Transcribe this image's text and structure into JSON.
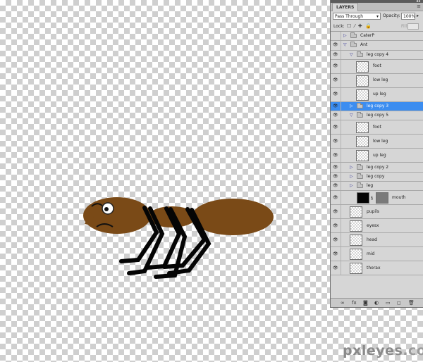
{
  "panel": {
    "tab_label": "LAYERS",
    "menu_icon": "panel-menu-icon",
    "blend_mode": "Pass Through",
    "opacity_label": "Opacity:",
    "opacity_value": "100%",
    "lock_label": "Lock:",
    "lock_icons": "☐ ⁄ ✚ 🔒",
    "fill_label": "Fill:"
  },
  "layers": [
    {
      "name": "CaterP",
      "kind": "group",
      "expanded": false,
      "indent": 0,
      "visible": false,
      "selected": false
    },
    {
      "name": "Ant",
      "kind": "group",
      "expanded": true,
      "indent": 0,
      "visible": true,
      "selected": false
    },
    {
      "name": "leg copy 4",
      "kind": "group",
      "expanded": true,
      "indent": 1,
      "visible": true,
      "selected": false
    },
    {
      "name": "foot",
      "kind": "layer",
      "indent": 2,
      "visible": true,
      "selected": false,
      "thumb": "transparent"
    },
    {
      "name": "low leg",
      "kind": "layer",
      "indent": 2,
      "visible": true,
      "selected": false,
      "thumb": "transparent"
    },
    {
      "name": "up leg",
      "kind": "layer",
      "indent": 2,
      "visible": true,
      "selected": false,
      "thumb": "transparent"
    },
    {
      "name": "leg copy 3",
      "kind": "group",
      "expanded": false,
      "indent": 1,
      "visible": true,
      "selected": true
    },
    {
      "name": "leg copy 5",
      "kind": "group",
      "expanded": true,
      "indent": 1,
      "visible": true,
      "selected": false
    },
    {
      "name": "foot",
      "kind": "layer",
      "indent": 2,
      "visible": true,
      "selected": false,
      "thumb": "transparent"
    },
    {
      "name": "low leg",
      "kind": "layer",
      "indent": 2,
      "visible": true,
      "selected": false,
      "thumb": "transparent"
    },
    {
      "name": "up leg",
      "kind": "layer",
      "indent": 2,
      "visible": true,
      "selected": false,
      "thumb": "transparent"
    },
    {
      "name": "leg copy 2",
      "kind": "group",
      "expanded": false,
      "indent": 1,
      "visible": true,
      "selected": false
    },
    {
      "name": "leg copy",
      "kind": "group",
      "expanded": false,
      "indent": 1,
      "visible": true,
      "selected": false
    },
    {
      "name": "leg",
      "kind": "group",
      "expanded": false,
      "indent": 1,
      "visible": true,
      "selected": false
    },
    {
      "name": "mouth",
      "kind": "masked",
      "indent": 1,
      "visible": true,
      "selected": false,
      "thumb": "black",
      "mask": "gray"
    },
    {
      "name": "pupils",
      "kind": "layer",
      "indent": 1,
      "visible": true,
      "selected": false,
      "thumb": "transparent"
    },
    {
      "name": "eyesx",
      "kind": "layer",
      "indent": 1,
      "visible": true,
      "selected": false,
      "thumb": "transparent"
    },
    {
      "name": "head",
      "kind": "layer",
      "indent": 1,
      "visible": true,
      "selected": false,
      "thumb": "transparent"
    },
    {
      "name": "mid",
      "kind": "layer",
      "indent": 1,
      "visible": true,
      "selected": false,
      "thumb": "transparent"
    },
    {
      "name": "thorax",
      "kind": "layer",
      "indent": 1,
      "visible": true,
      "selected": false,
      "thumb": "transparent"
    }
  ],
  "bottom_icons": [
    "link-layers-icon",
    "fx-icon",
    "add-mask-icon",
    "adjustment-icon",
    "new-group-icon",
    "new-layer-icon",
    "trash-icon"
  ],
  "bottom_glyphs": [
    "∞",
    "fx",
    "◙",
    "◐",
    "▭",
    "◻",
    "🗑"
  ],
  "watermark": {
    "main": "pxleyes",
    "tld": ".com"
  },
  "colors": {
    "ant_brown": "#7a4a17",
    "selection": "#3c8df0"
  }
}
